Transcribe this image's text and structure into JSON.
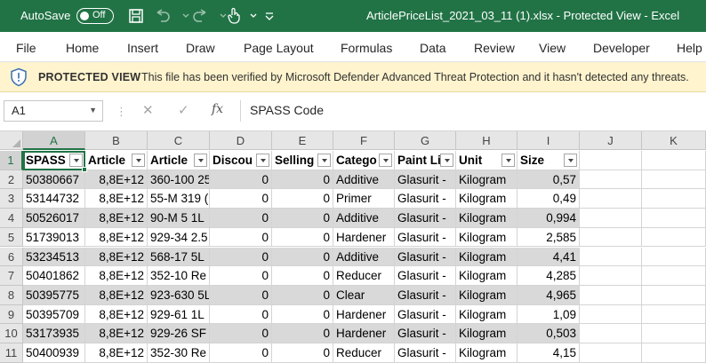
{
  "window": {
    "autosave_label": "AutoSave",
    "autosave_state": "Off",
    "title": "ArticlePriceList_2021_03_11 (1).xlsx  -  Protected View  -  Excel"
  },
  "menu": [
    "File",
    "Home",
    "Insert",
    "Draw",
    "Page Layout",
    "Formulas",
    "Data",
    "Review",
    "View",
    "Developer",
    "Help"
  ],
  "banner": {
    "title": "PROTECTED VIEW",
    "message": "This file has been verified by Microsoft Defender Advanced Threat Protection and it hasn't detected any threats."
  },
  "formula_bar": {
    "name_box": "A1",
    "fx_label": "fx",
    "content": "SPASS Code"
  },
  "columns": [
    "A",
    "B",
    "C",
    "D",
    "E",
    "F",
    "G",
    "H",
    "I",
    "J",
    "K"
  ],
  "rows": [
    "1",
    "2",
    "3",
    "4",
    "5",
    "6",
    "7",
    "8",
    "9",
    "10",
    "11"
  ],
  "headers": [
    "SPASS C",
    "Article",
    "Article",
    "Discou",
    "Selling",
    "Catego",
    "Paint Li",
    "Unit",
    "Size"
  ],
  "data_rows": [
    [
      "50380667",
      "8,8E+12",
      "360-100 25",
      "0",
      "0",
      "Additive",
      "Glasurit - ",
      "Kilogram",
      "0,57"
    ],
    [
      "53144732",
      "8,8E+12",
      "55-M 319 (",
      "0",
      "0",
      "Primer",
      "Glasurit - ",
      "Kilogram",
      "0,49"
    ],
    [
      "50526017",
      "8,8E+12",
      "90-M 5 1L",
      "0",
      "0",
      "Additive",
      "Glasurit - ",
      "Kilogram",
      "0,994"
    ],
    [
      "51739013",
      "8,8E+12",
      "929-34 2.5",
      "0",
      "0",
      "Hardener",
      "Glasurit - ",
      "Kilogram",
      "2,585"
    ],
    [
      "53234513",
      "8,8E+12",
      "568-17 5L",
      "0",
      "0",
      "Additive",
      "Glasurit - ",
      "Kilogram",
      "4,41"
    ],
    [
      "50401862",
      "8,8E+12",
      "352-10 Re",
      "0",
      "0",
      "Reducer",
      "Glasurit - ",
      "Kilogram",
      "4,285"
    ],
    [
      "50395775",
      "8,8E+12",
      "923-630 5L",
      "0",
      "0",
      "Clear",
      "Glasurit - ",
      "Kilogram",
      "4,965"
    ],
    [
      "50395709",
      "8,8E+12",
      "929-61 1L",
      "0",
      "0",
      "Hardener",
      "Glasurit - ",
      "Kilogram",
      "1,09"
    ],
    [
      "53173935",
      "8,8E+12",
      "929-26 SF",
      "0",
      "0",
      "Hardener",
      "Glasurit - ",
      "Kilogram",
      "0,503"
    ],
    [
      "50400939",
      "8,8E+12",
      "352-30 Re",
      "0",
      "0",
      "Reducer",
      "Glasurit - ",
      "Kilogram",
      "4,15"
    ]
  ],
  "colors": {
    "excel_green": "#217346",
    "banner_bg": "#fff4ce",
    "band_gray": "#d9d9d9"
  }
}
